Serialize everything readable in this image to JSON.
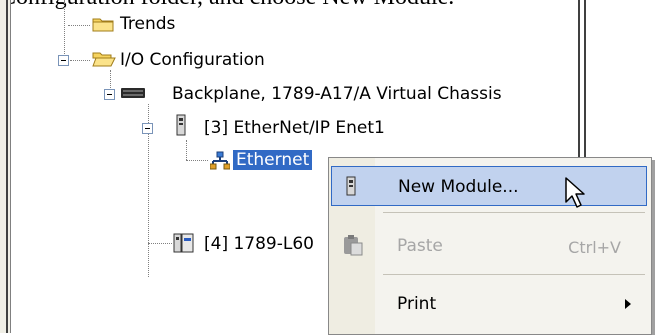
{
  "caption": "Configuration folder, and choose New Module.",
  "tree": {
    "trends": "Trends",
    "io_configuration": "I/O Configuration",
    "backplane": "Backplane, 1789-A17/A Virtual Chassis",
    "ethernet_module": "[3] EtherNet/IP Enet1",
    "ethernet_node": "Ethernet",
    "controller": "[4] 1789-L60"
  },
  "context_menu": {
    "items": [
      {
        "label": "New Module...",
        "shortcut": "",
        "enabled": true,
        "highlighted": true
      },
      {
        "label": "Paste",
        "shortcut": "Ctrl+V",
        "enabled": false,
        "highlighted": false
      },
      {
        "label": "Print",
        "shortcut": "",
        "enabled": true,
        "highlighted": false,
        "submenu": true
      }
    ]
  },
  "colors": {
    "selection": "#316ac5",
    "menu_highlight": "#c1d2ee",
    "folder": "#f6d35f"
  }
}
